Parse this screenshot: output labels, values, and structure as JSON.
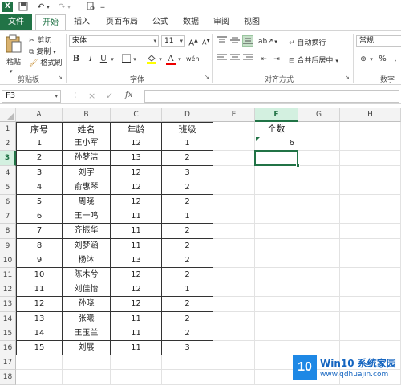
{
  "app": {
    "brand_color": "#217346"
  },
  "quick_access": [
    "save-icon",
    "undo-icon",
    "redo-icon",
    "print-preview-icon"
  ],
  "tabs": [
    {
      "label": "文件",
      "active": false
    },
    {
      "label": "开始",
      "active": true
    },
    {
      "label": "插入",
      "active": false
    },
    {
      "label": "页面布局",
      "active": false
    },
    {
      "label": "公式",
      "active": false
    },
    {
      "label": "数据",
      "active": false
    },
    {
      "label": "审阅",
      "active": false
    },
    {
      "label": "视图",
      "active": false
    }
  ],
  "ribbon": {
    "clipboard": {
      "paste": "粘贴",
      "cut": "剪切",
      "copy": "复制",
      "format_painter": "格式刷",
      "group": "剪贴板"
    },
    "font": {
      "name": "宋体",
      "size": "11",
      "grow": "A",
      "shrink": "A",
      "bold": "B",
      "italic": "I",
      "underline": "U",
      "group": "字体"
    },
    "alignment": {
      "wrap": "自动换行",
      "merge": "合并后居中",
      "group": "对齐方式"
    },
    "number": {
      "format": "常规",
      "percent": "%",
      "group": "数字"
    }
  },
  "formula_bar": {
    "name_box": "F3",
    "cancel": "×",
    "confirm": "✓",
    "fx": "fx",
    "value": ""
  },
  "sheet": {
    "columns": [
      "A",
      "B",
      "C",
      "D",
      "E",
      "F",
      "G",
      "H"
    ],
    "rows": [
      "1",
      "2",
      "3",
      "4",
      "5",
      "6",
      "7",
      "8",
      "9",
      "10",
      "11",
      "12",
      "13",
      "14",
      "15",
      "16",
      "17",
      "18"
    ],
    "active_cell": "F3",
    "header": [
      "序号",
      "姓名",
      "年龄",
      "班级"
    ],
    "data": [
      [
        "1",
        "王小军",
        "12",
        "1"
      ],
      [
        "2",
        "孙梦洁",
        "13",
        "2"
      ],
      [
        "3",
        "刘宇",
        "12",
        "3"
      ],
      [
        "4",
        "俞惠琴",
        "12",
        "2"
      ],
      [
        "5",
        "周晓",
        "12",
        "2"
      ],
      [
        "6",
        "王一鸣",
        "11",
        "1"
      ],
      [
        "7",
        "齐振华",
        "11",
        "2"
      ],
      [
        "8",
        "刘梦涵",
        "11",
        "2"
      ],
      [
        "9",
        "杨沐",
        "13",
        "2"
      ],
      [
        "10",
        "陈木兮",
        "12",
        "2"
      ],
      [
        "11",
        "刘佳怡",
        "12",
        "1"
      ],
      [
        "12",
        "孙晓",
        "12",
        "2"
      ],
      [
        "13",
        "张曦",
        "11",
        "2"
      ],
      [
        "14",
        "王玉兰",
        "11",
        "2"
      ],
      [
        "15",
        "刘展",
        "11",
        "3"
      ]
    ],
    "f1": "个数",
    "f2": "6"
  },
  "watermark": {
    "logo": "10",
    "title": "Win10 系统家园",
    "url": "www.qdhuajin.com"
  }
}
